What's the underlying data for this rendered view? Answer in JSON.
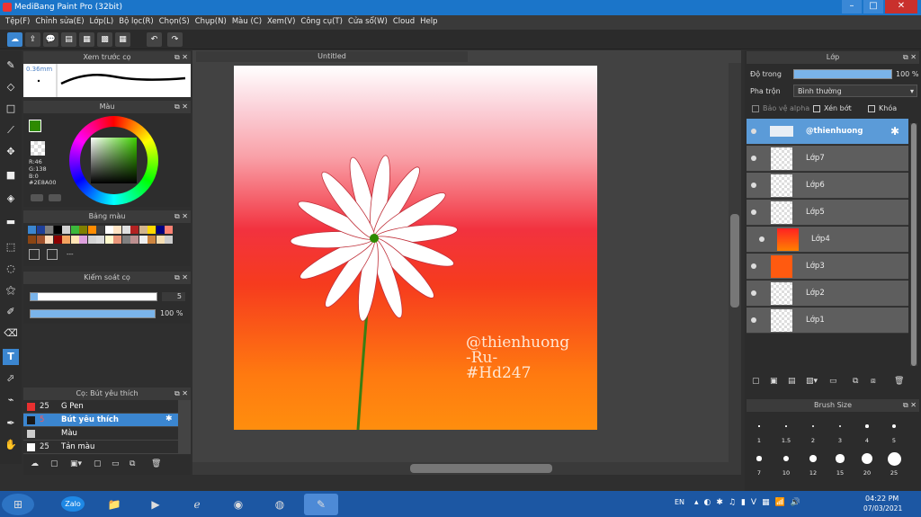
{
  "title": "MediBang Paint Pro (32bit)",
  "window_buttons": [
    "–",
    "□",
    "✕"
  ],
  "menu": [
    "Tệp(F)",
    "Chỉnh sửa(E)",
    "Lớp(L)",
    "Bộ lọc(R)",
    "Chọn(S)",
    "Chụp(N)",
    "Màu (C)",
    "Xem(V)",
    "Công cụ(T)",
    "Cửa sổ(W)",
    "Cloud",
    "Help"
  ],
  "brush_preview": {
    "title": "Xem trước cọ",
    "size": "0.36mm"
  },
  "color_panel": {
    "title": "Màu",
    "r": "R:46",
    "g": "G:138",
    "b": "B:0",
    "hex": "#2E8A00",
    "fg": "#2e8a00",
    "bg": "#ff6a00"
  },
  "palette": {
    "title": "Bảng màu",
    "text": "---"
  },
  "brush_control": {
    "title": "Kiểm soát cọ",
    "size_value": "5",
    "opacity_value": "100 %"
  },
  "brush_list": {
    "title": "Cọ: Bút yêu thích",
    "items": [
      {
        "size": "25",
        "name": "G Pen",
        "color": "#e83030"
      },
      {
        "size": "5",
        "name": "Bút yêu thích",
        "color": "#1a1a1a"
      },
      {
        "size": "",
        "name": "Màu",
        "color": "#cccccc"
      },
      {
        "size": "25",
        "name": "Tản màu",
        "color": "#ffffff"
      }
    ]
  },
  "document": {
    "tab": "Untitled",
    "watermark": [
      "@thienhuong",
      "-Ru-",
      "#Hd247"
    ]
  },
  "layers_panel": {
    "title": "Lớp",
    "opacity_label": "Độ trong",
    "opacity_value": "100 %",
    "opacity": 1.0,
    "blend_label": "Pha trộn",
    "blend_value": "Bình thường",
    "alpha_protect": "Bảo vệ alpha",
    "clip": "Xén bớt",
    "lock": "Khóa"
  },
  "layers": [
    {
      "name": "@thienhuong",
      "selected": true
    },
    {
      "name": "Lớp7"
    },
    {
      "name": "Lớp6"
    },
    {
      "name": "Lớp5"
    },
    {
      "name": "Lớp4"
    },
    {
      "name": "Lớp3"
    },
    {
      "name": "Lớp2"
    },
    {
      "name": "Lớp1"
    }
  ],
  "brush_size": {
    "title": "Brush Size",
    "labels": [
      "1",
      "1.5",
      "2",
      "3",
      "4",
      "5",
      "7",
      "10",
      "12",
      "15",
      "20",
      "25"
    ]
  },
  "taskbar": {
    "lang": "EN",
    "time": "04:22 PM",
    "date": "07/03/2021",
    "zalo": "Zalo"
  }
}
